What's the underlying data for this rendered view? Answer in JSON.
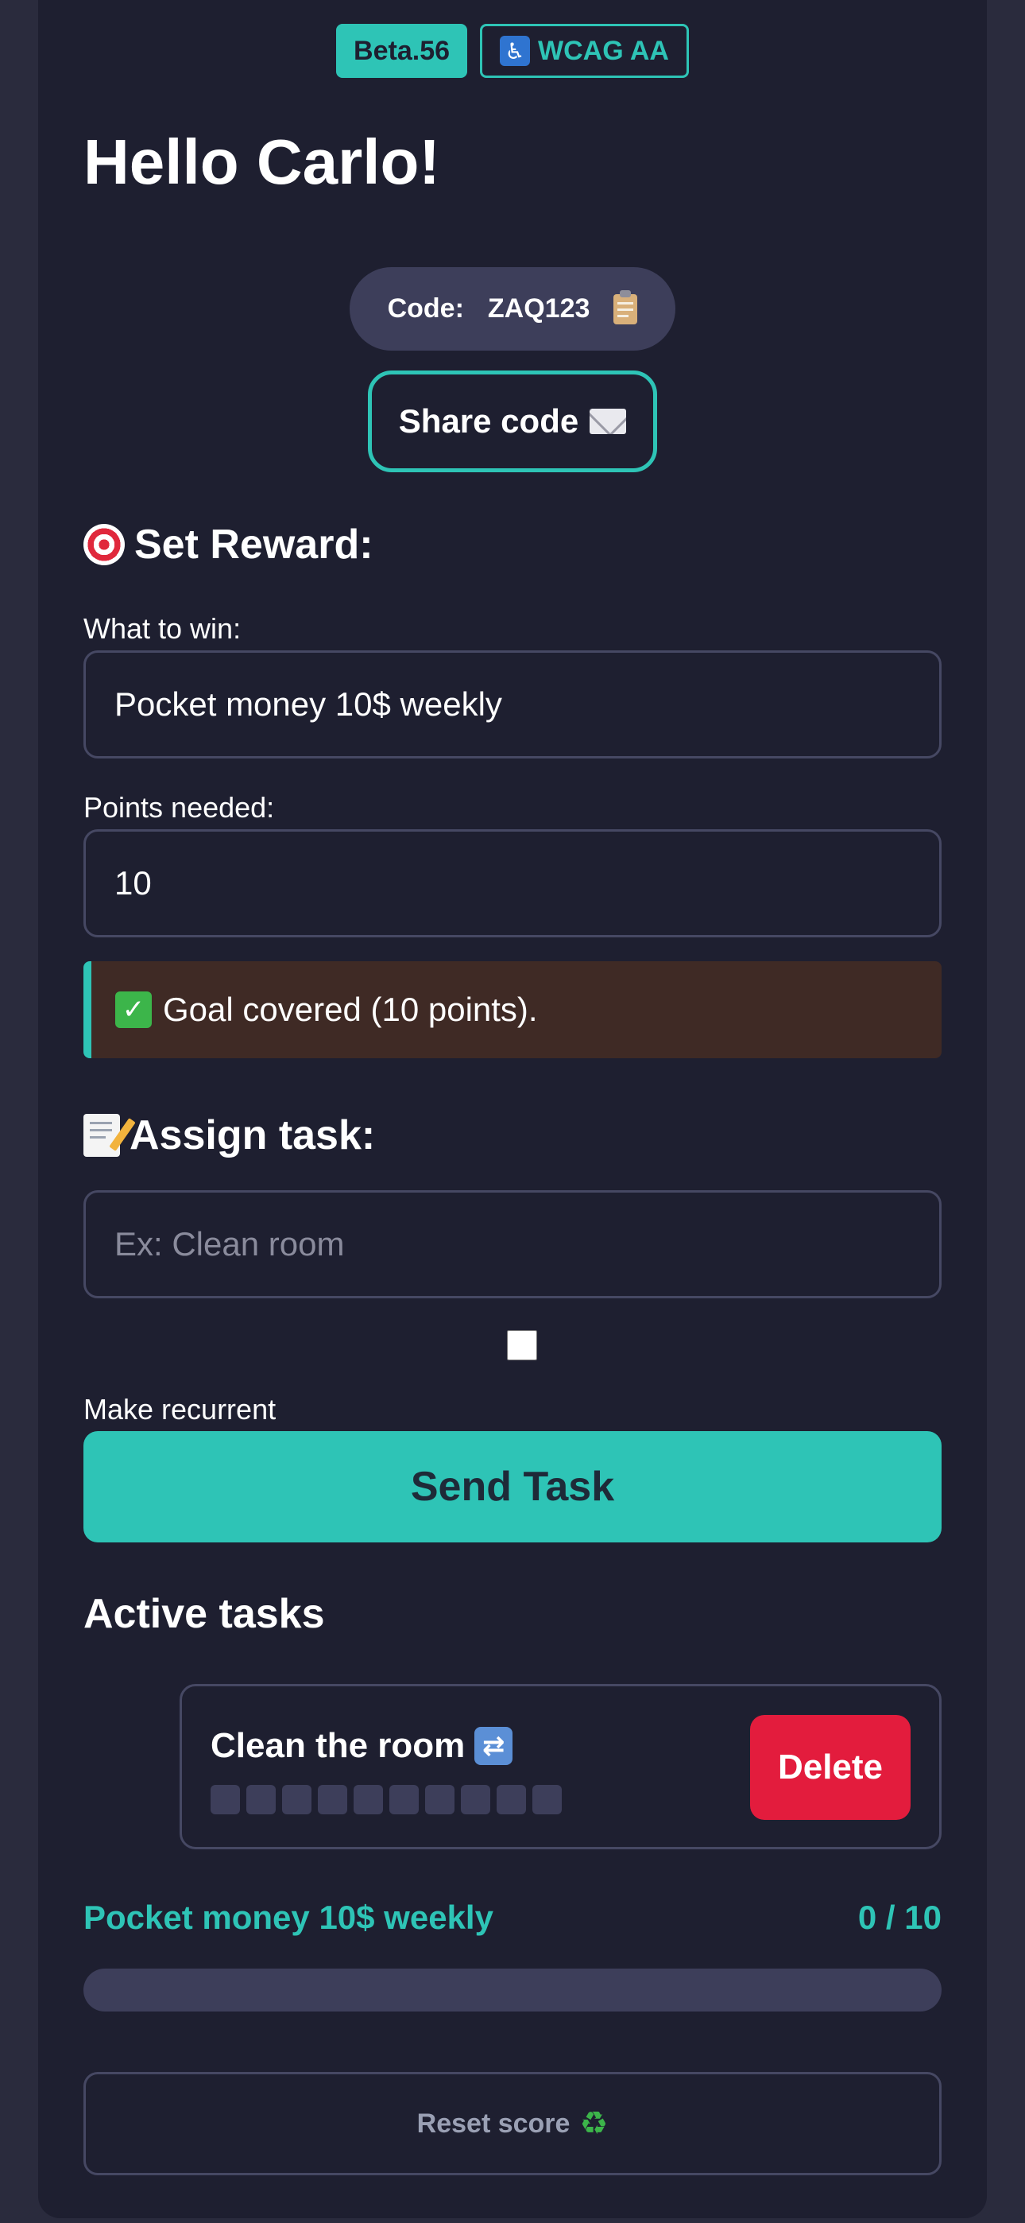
{
  "header": {
    "version_badge": "Beta.56",
    "wcag_badge": "WCAG AA",
    "wcag_icon": "♿"
  },
  "greeting": "Hello Carlo!",
  "code": {
    "label": "Code:",
    "value": "ZAQ123"
  },
  "share_button": "Share code",
  "reward": {
    "title": "Set Reward:",
    "win_label": "What to win:",
    "win_value": "Pocket money 10$ weekly",
    "points_label": "Points needed:",
    "points_value": "10",
    "goal_message": "Goal covered (10 points)."
  },
  "assign": {
    "title": "Assign task:",
    "task_placeholder": "Ex: Clean room",
    "recurrent_label": "Make recurrent",
    "recurrent_checked": false,
    "send_button": "Send Task"
  },
  "active_tasks": {
    "title": "Active tasks",
    "items": [
      {
        "name": "Clean the room",
        "recurrent_icon": "🔁",
        "completed": 0,
        "total": 10,
        "delete_label": "Delete"
      }
    ]
  },
  "progress": {
    "reward_name": "Pocket money 10$ weekly",
    "score_text": "0 / 10",
    "fraction": 0
  },
  "reset_button": "Reset score",
  "icons": {
    "check": "✓",
    "recycle": "♻",
    "repeat": "⇄"
  },
  "colors": {
    "accent": "#2ec4b6",
    "danger": "#e31c3d",
    "background": "#1e1f30",
    "panel_outer": "#2a2b3d",
    "goal_banner": "#3f2a25",
    "track": "#3d3e5a"
  }
}
